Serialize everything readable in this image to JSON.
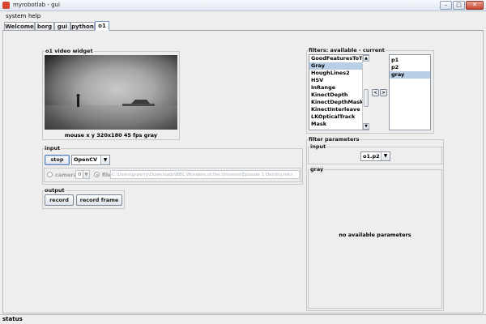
{
  "window": {
    "title": "myrobotlab - gui",
    "minimize": "–",
    "maximize": "□",
    "close": "✕"
  },
  "menu": [
    "system",
    "help"
  ],
  "tabs": [
    "Welcome",
    "borg",
    "gui",
    "python",
    "o1"
  ],
  "active_tab": "o1",
  "video": {
    "group_title": "o1  video widget",
    "status": "mouse x y  320x180  45 fps  gray"
  },
  "input_panel": {
    "group_title": "input",
    "stop_label": "stop",
    "capture_select": "OpenCV",
    "camera_label": "camera",
    "camera_index": "0",
    "file_label": "file",
    "file_path": "C:\\Users\\grperry\\Downloads\\BBC.Wonders.of.the.Universe\\Episode 1 Destiny.mkv"
  },
  "output_panel": {
    "group_title": "output",
    "record_label": "record",
    "record_frame_label": "record frame"
  },
  "filters": {
    "group_title": "filters: available - current",
    "available": [
      "GoodFeaturesToTrack",
      "Gray",
      "HoughLines2",
      "HSV",
      "InRange",
      "KinectDepth",
      "KinectDepthMask",
      "KinectInterleave",
      "LKOpticalTrack",
      "Mask"
    ],
    "available_selected": "Gray",
    "current": [
      "p1",
      "p2",
      "gray"
    ],
    "current_selected": "gray",
    "remove_arrow": "<",
    "add_arrow": ">"
  },
  "filter_params": {
    "group_title": "filter parameters",
    "input_title": "input",
    "input_select": "o1.p2",
    "gray_title": "gray",
    "message": "no available parameters"
  },
  "status_bar": "status"
}
